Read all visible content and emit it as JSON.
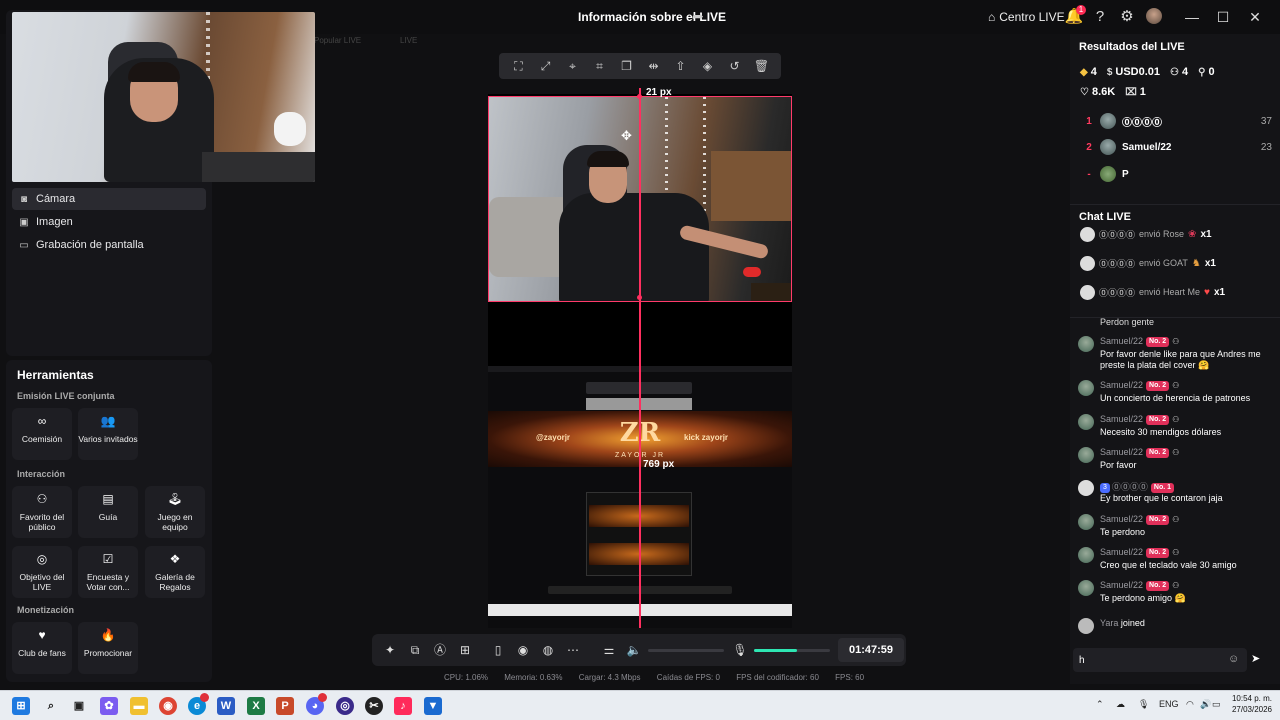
{
  "titlebar": {
    "title": "Información sobre el LIVE",
    "centro_label": "Centro LIVE",
    "notif_count": "1",
    "icons": [
      "home-icon",
      "bell-icon",
      "help-icon",
      "gear-icon",
      "avatar",
      "minimize-icon",
      "maximize-icon",
      "close-icon"
    ]
  },
  "ghost_tabs": [
    "Popular LIVE",
    "LIVE"
  ],
  "sources": [
    {
      "label": "Cámara",
      "icon": "camera-icon",
      "active": true
    },
    {
      "label": "Imagen",
      "icon": "image-icon",
      "active": false
    },
    {
      "label": "Grabación de pantalla",
      "icon": "monitor-icon",
      "active": false
    }
  ],
  "tools": {
    "title": "Herramientas",
    "sections": {
      "joint": "Emisión LIVE conjunta",
      "interaction": "Interacción",
      "monetization": "Monetización"
    },
    "joint": [
      {
        "label": "Coemisión",
        "icon": "link-icon"
      },
      {
        "label": "Varios invitados",
        "icon": "users-icon"
      }
    ],
    "interaction": [
      {
        "label": "Favorito del público",
        "icon": "audience-icon"
      },
      {
        "label": "Guía",
        "icon": "guide-icon"
      },
      {
        "label": "Juego en equipo",
        "icon": "joystick-icon"
      },
      {
        "label": "Objetivo del LIVE",
        "icon": "target-icon"
      },
      {
        "label": "Encuesta y Votar con...",
        "icon": "poll-icon"
      },
      {
        "label": "Galería de Regalos",
        "icon": "gift-gallery-icon"
      }
    ],
    "monetization": [
      {
        "label": "Club de fans",
        "icon": "heart-icon"
      },
      {
        "label": "Promocionar",
        "icon": "flame-icon"
      }
    ]
  },
  "canvas": {
    "top_label": "21 px",
    "mid_label": "769 px",
    "banner_left": "@zayorjr",
    "banner_right": "kick  zayorjr",
    "logo_text": "ZAYOR JR",
    "logo_mark": "ZR"
  },
  "control_bar": {
    "timer": "01:47:59",
    "mic_level": 0.57
  },
  "stats": {
    "cpu": "CPU: 1.06%",
    "memoria": "Memoria: 0.63%",
    "cargar": "Cargar: 4.3 Mbps",
    "caidas": "Caídas de FPS: 0",
    "fps_cod": "FPS del codificador: 60",
    "fps": "FPS: 60"
  },
  "results": {
    "title": "Resultados del LIVE",
    "coins": "4",
    "usd": "USD0.01",
    "viewers": "4",
    "new_followers": "0",
    "likes": "8.6K",
    "gifts": "1",
    "ranking": [
      {
        "rank": "1",
        "name": "⓪⓪⓪⓪",
        "score": "37"
      },
      {
        "rank": "2",
        "name": "Samuel/22",
        "score": "23"
      },
      {
        "rank": "-",
        "name": "P",
        "score": ""
      }
    ]
  },
  "chat": {
    "title": "Chat LIVE",
    "gifts": [
      {
        "user": "⓪⓪⓪⓪",
        "text": "envió Rose",
        "icon": "rose-gift-icon",
        "count": "x1"
      },
      {
        "user": "⓪⓪⓪⓪",
        "text": "envió GOAT",
        "icon": "goat-gift-icon",
        "count": "x1"
      },
      {
        "user": "⓪⓪⓪⓪",
        "text": "envió Heart Me",
        "icon": "heartme-gift-icon",
        "count": "x1"
      }
    ],
    "partial_msg": "Perdon gente",
    "messages": [
      {
        "user": "Samuel/22",
        "level": "No. 2",
        "text": "Por favor denle like para que Andres me preste la plata del cover 🤗"
      },
      {
        "user": "Samuel/22",
        "level": "No. 2",
        "text": "Un concierto de herencia de patrones"
      },
      {
        "user": "Samuel/22",
        "level": "No. 2",
        "text": "Necesito 30 mendigos dólares"
      },
      {
        "user": "Samuel/22",
        "level": "No. 2",
        "text": "Por favor"
      },
      {
        "user": "⓪⓪⓪⓪",
        "level": "No. 1",
        "badge": "3",
        "text": "Ey brother que le contaron jaja"
      },
      {
        "user": "Samuel/22",
        "level": "No. 2",
        "text": "Te perdono"
      },
      {
        "user": "Samuel/22",
        "level": "No. 2",
        "text": "Creo que el teclado vale 30 amigo"
      },
      {
        "user": "Samuel/22",
        "level": "No. 2",
        "text": "Te perdono amigo 🤗"
      }
    ],
    "join": {
      "user": "Yara",
      "text": "joined"
    },
    "input_value": "h"
  },
  "taskbar": {
    "lang": "ENG",
    "time": "10:54 p. m.",
    "date": "27/03/2026"
  },
  "colors": {
    "accent": "#ff2f5f",
    "mic_fill": "#2ee6b3",
    "level_badge": "#e0305a"
  }
}
